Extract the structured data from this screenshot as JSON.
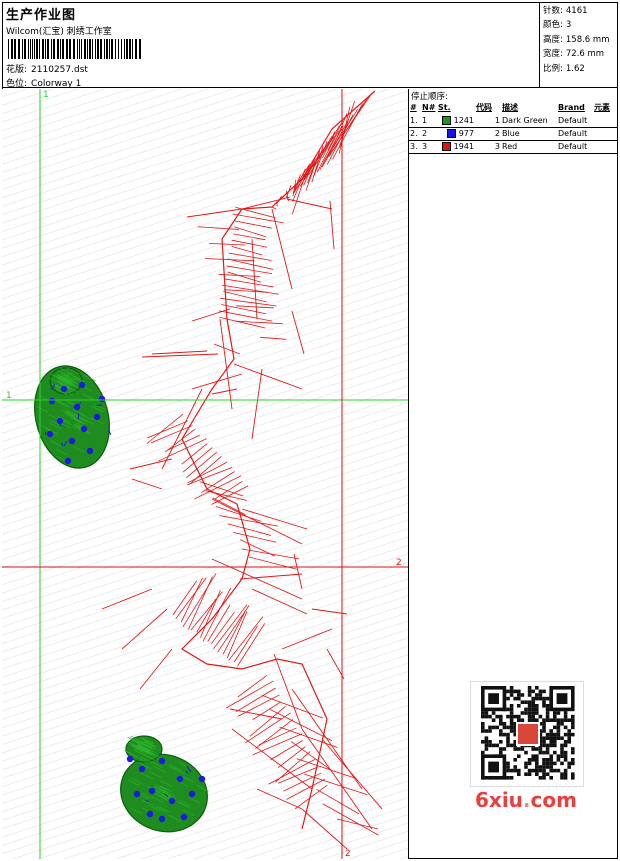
{
  "header": {
    "title": "生产作业图",
    "company": "Wilcom(汇宝) 刺绣工作室",
    "design_label": "花版:",
    "design_value": "2110257.dst",
    "colorway_label": "色位:",
    "colorway_value": "Colorway 1"
  },
  "stats": [
    {
      "label": "针数:",
      "value": "4161"
    },
    {
      "label": "颜色:",
      "value": "3"
    },
    {
      "label": "高度:",
      "value": "158.6 mm"
    },
    {
      "label": "宽度:",
      "value": "72.6 mm"
    },
    {
      "label": "比例:",
      "value": "1.62"
    }
  ],
  "guides": {
    "vertical_1": "1",
    "horizontal_1": "1",
    "vertical_2": "2",
    "horizontal_2": "2"
  },
  "stop_sequence": {
    "title": "停止顺序:",
    "columns": [
      "#",
      "N#",
      "St.",
      "代码",
      "描述",
      "Brand",
      "元素"
    ],
    "rows": [
      {
        "index": "1.",
        "needle": "1",
        "swatch_color": "#189a18",
        "stitches": "1241",
        "code": "1",
        "description": "Dark Green",
        "brand": "Default"
      },
      {
        "index": "2.",
        "needle": "2",
        "swatch_color": "#1414e6",
        "stitches": "977",
        "code": "2",
        "description": "Blue",
        "brand": "Default"
      },
      {
        "index": "3.",
        "needle": "3",
        "swatch_color": "#e01414",
        "stitches": "1941",
        "code": "3",
        "description": "Red",
        "brand": "Default"
      }
    ]
  },
  "colors": {
    "guide_green": "#2ad42a",
    "guide_red": "#dd1111",
    "thread_green": "#1e8c1e",
    "thread_blue": "#1a1ae0",
    "thread_red": "#e01818"
  },
  "watermark": {
    "text_a": "6xiu",
    "text_dot": ".",
    "text_b": "com"
  }
}
